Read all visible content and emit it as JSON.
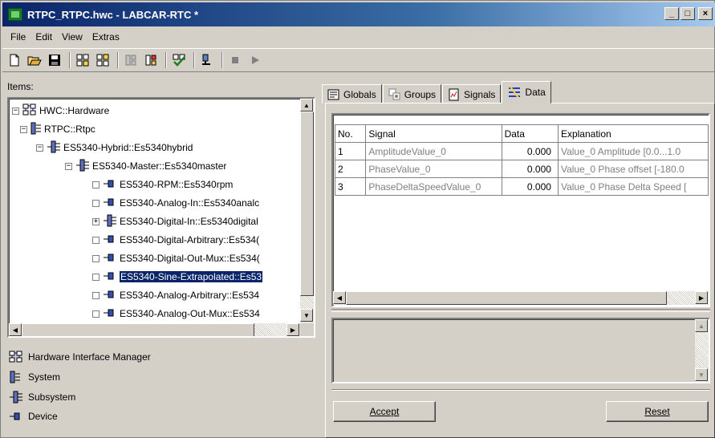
{
  "window": {
    "title": "RTPC_RTPC.hwc - LABCAR-RTC  *",
    "minimize": "_",
    "maximize": "□",
    "close": "×"
  },
  "menu": [
    "File",
    "Edit",
    "View",
    "Extras"
  ],
  "toolbar": {
    "buttons": [
      "new-icon",
      "open-icon",
      "save-icon",
      "hw-a-icon",
      "hw-b-icon",
      "hw-c-icon",
      "hw-d-icon",
      "check-icon",
      "connect-icon",
      "stop-icon",
      "play-icon"
    ]
  },
  "left": {
    "items_label": "Items:",
    "tree": [
      {
        "label": "HWC::Hardware",
        "level": 0,
        "expander": "−",
        "icon": "hwc"
      },
      {
        "label": "RTPC::Rtpc",
        "level": 1,
        "expander": "−",
        "icon": "system"
      },
      {
        "label": "ES5340-Hybrid::Es5340hybrid",
        "level": 2,
        "expander": "−",
        "icon": "subsystem"
      },
      {
        "label": "ES5340-Master::Es5340master",
        "level": 3,
        "expander": "−",
        "icon": "subsystem"
      },
      {
        "label": "ES5340-RPM::Es5340rpm",
        "level": 4,
        "expander": "",
        "icon": "device"
      },
      {
        "label": "ES5340-Analog-In::Es5340analc",
        "level": 4,
        "expander": "",
        "icon": "device"
      },
      {
        "label": "ES5340-Digital-In::Es5340digital",
        "level": 4,
        "expander": "+",
        "icon": "subsystem"
      },
      {
        "label": "ES5340-Digital-Arbitrary::Es534(",
        "level": 4,
        "expander": "",
        "icon": "device"
      },
      {
        "label": "ES5340-Digital-Out-Mux::Es534(",
        "level": 4,
        "expander": "",
        "icon": "device"
      },
      {
        "label": "ES5340-Sine-Extrapolated::Es53",
        "level": 4,
        "expander": "",
        "icon": "device",
        "selected": true
      },
      {
        "label": "ES5340-Analog-Arbitrary::Es534",
        "level": 4,
        "expander": "",
        "icon": "device"
      },
      {
        "label": "ES5340-Analog-Out-Mux::Es534",
        "level": 4,
        "expander": "",
        "icon": "device"
      }
    ],
    "legend": [
      {
        "label": "Hardware Interface Manager",
        "icon": "hwc"
      },
      {
        "label": "System",
        "icon": "system"
      },
      {
        "label": "Subsystem",
        "icon": "subsystem"
      },
      {
        "label": "Device",
        "icon": "device"
      }
    ]
  },
  "tabs": [
    {
      "label": "Globals",
      "icon": "globals-icon",
      "active": false
    },
    {
      "label": "Groups",
      "icon": "groups-icon",
      "active": false
    },
    {
      "label": "Signals",
      "icon": "signals-icon",
      "active": false
    },
    {
      "label": "Data",
      "icon": "data-icon",
      "active": true
    }
  ],
  "grid": {
    "headers": [
      "No.",
      "Signal",
      "Data",
      "Explanation"
    ],
    "rows": [
      {
        "no": "1",
        "signal": "AmplitudeValue_0",
        "data": "0.000",
        "explanation": "Value_0 Amplitude [0.0...1.0"
      },
      {
        "no": "2",
        "signal": "PhaseValue_0",
        "data": "0.000",
        "explanation": "Value_0 Phase offset [-180.0"
      },
      {
        "no": "3",
        "signal": "PhaseDeltaSpeedValue_0",
        "data": "0.000",
        "explanation": "Value_0 Phase Delta Speed ["
      }
    ]
  },
  "buttons": {
    "accept": "Accept",
    "reset": "Reset"
  },
  "colors": {
    "title_start": "#0a246a",
    "title_end": "#a6caf0",
    "face": "#d4d0c8",
    "selection": "#0a246a"
  }
}
